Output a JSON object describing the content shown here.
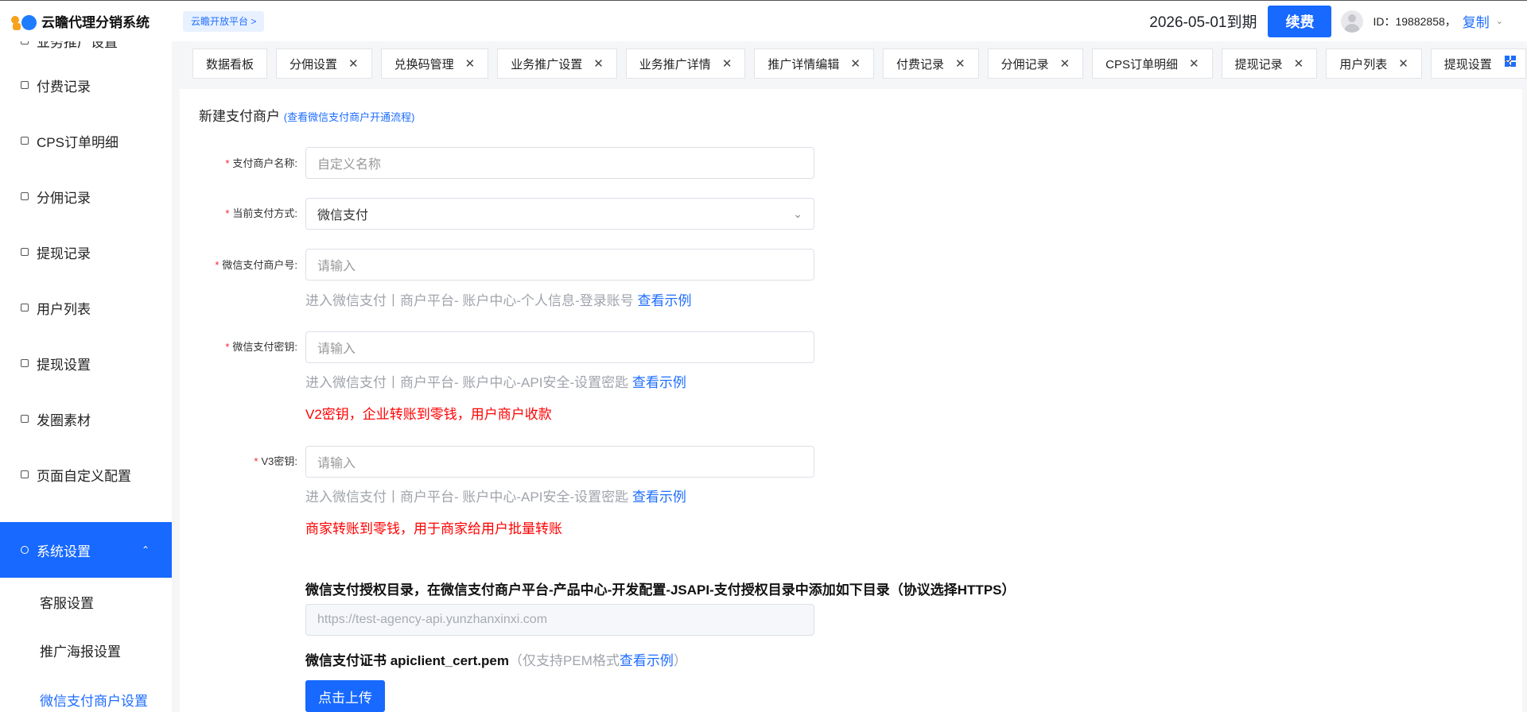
{
  "header": {
    "app_title": "云瞻代理分销系统",
    "platform_tag": "云瞻开放平台 >",
    "expire_text": "2026-05-01到期",
    "renew_label": "续费",
    "user_id": "ID：19882858，",
    "copy_label": "复制"
  },
  "sidebar": {
    "items": [
      {
        "label": "业务推广设置",
        "icon": "promote-icon"
      },
      {
        "label": "付费记录",
        "icon": "payment-icon"
      },
      {
        "label": "CPS订单明细",
        "icon": "order-icon"
      },
      {
        "label": "分佣记录",
        "icon": "commission-icon"
      },
      {
        "label": "提现记录",
        "icon": "withdraw-record-icon"
      },
      {
        "label": "用户列表",
        "icon": "user-icon"
      },
      {
        "label": "提现设置",
        "icon": "withdraw-setting-icon"
      },
      {
        "label": "发圈素材",
        "icon": "material-icon"
      },
      {
        "label": "页面自定义配置",
        "icon": "page-config-icon"
      },
      {
        "label": "系统设置",
        "icon": "settings-icon"
      }
    ],
    "sub_items": [
      {
        "label": "客服设置"
      },
      {
        "label": "推广海报设置"
      },
      {
        "label": "微信支付商户设置"
      }
    ]
  },
  "tabs": [
    {
      "label": "数据看板"
    },
    {
      "label": "分佣设置"
    },
    {
      "label": "兑换码管理"
    },
    {
      "label": "业务推广设置"
    },
    {
      "label": "业务推广详情"
    },
    {
      "label": "推广详情编辑"
    },
    {
      "label": "付费记录"
    },
    {
      "label": "分佣记录"
    },
    {
      "label": "CPS订单明细"
    },
    {
      "label": "提现记录"
    },
    {
      "label": "用户列表"
    },
    {
      "label": "提现设置"
    }
  ],
  "form": {
    "title": "新建支付商户",
    "title_link": "(查看微信支付商户开通流程)",
    "merchant_name_label": "支付商户名称:",
    "merchant_name_placeholder": "自定义名称",
    "pay_method_label": "当前支付方式:",
    "pay_method_value": "微信支付",
    "mch_id_label": "微信支付商户号:",
    "mch_id_placeholder": "请输入",
    "mch_id_hint": "进入微信支付丨商户平台- 账户中心-个人信息-登录账号",
    "view_example": "查看示例",
    "key_label": "微信支付密钥:",
    "key_placeholder": "请输入",
    "key_hint": "进入微信支付丨商户平台- 账户中心-API安全-设置密匙",
    "key_warn": "V2密钥，企业转账到零钱，用户商户收款",
    "v3_label": "V3密钥:",
    "v3_placeholder": "请输入",
    "v3_hint": "进入微信支付丨商户平台- 账户中心-API安全-设置密匙",
    "v3_warn": "商家转账到零钱，用于商家给用户批量转账",
    "auth_dir_text": "微信支付授权目录，在微信支付商户平台-产品中心-开发配置-JSAPI-支付授权目录中添加如下目录（协议选择HTTPS）",
    "auth_dir_url": "https://test-agency-api.yunzhanxinxi.com",
    "cert_label": "微信支付证书 apiclient_cert.pem",
    "cert_note": "（仅支持PEM格式",
    "cert_note_end": "）",
    "upload_label": "点击上传"
  },
  "colors": {
    "primary": "#1769ff",
    "warning_text": "#ff0000",
    "logo_orange": "#f7a21b"
  }
}
